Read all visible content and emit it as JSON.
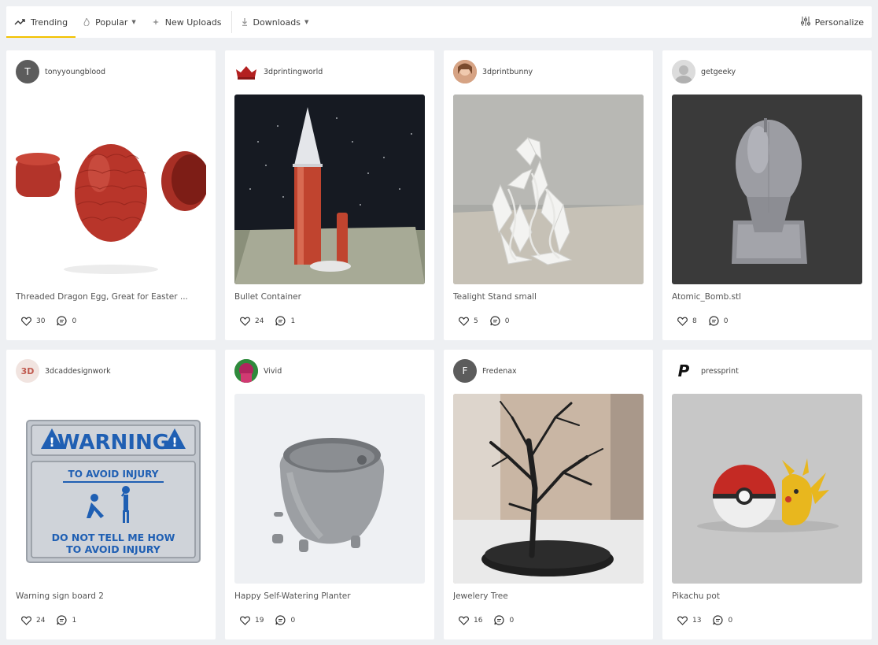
{
  "nav": {
    "tabs": [
      {
        "label": "Trending",
        "icon": "trending-icon",
        "active": true
      },
      {
        "label": "Popular",
        "icon": "flame-icon",
        "dropdown": true
      },
      {
        "label": "New Uploads",
        "icon": "sparkle-icon"
      },
      {
        "label": "Downloads",
        "icon": "download-icon",
        "dropdown": true
      }
    ],
    "personalize_label": "Personalize",
    "accent_color": "#f2c200"
  },
  "cards": [
    {
      "author": "tonyyoungblood",
      "avatar_letter": "T",
      "title": "Threaded Dragon Egg, Great for Easter ...",
      "likes": "30",
      "comments": "0"
    },
    {
      "author": "3dprintingworld",
      "avatar_letter": "",
      "title": "Bullet Container",
      "likes": "24",
      "comments": "1"
    },
    {
      "author": "3dprintbunny",
      "avatar_letter": "",
      "title": "Tealight Stand small",
      "likes": "5",
      "comments": "0"
    },
    {
      "author": "getgeeky",
      "avatar_letter": "",
      "title": "Atomic_Bomb.stl",
      "likes": "8",
      "comments": "0"
    },
    {
      "author": "3dcaddesignwork",
      "avatar_letter": "3D",
      "title": "Warning sign board 2",
      "likes": "24",
      "comments": "1"
    },
    {
      "author": "Vivid",
      "avatar_letter": "",
      "title": "Happy Self-Watering Planter",
      "likes": "19",
      "comments": "0"
    },
    {
      "author": "Fredenax",
      "avatar_letter": "F",
      "title": "Jewelery Tree",
      "likes": "16",
      "comments": "0"
    },
    {
      "author": "pressprint",
      "avatar_letter": "P",
      "title": "Pikachu pot",
      "likes": "13",
      "comments": "0"
    }
  ],
  "warning_sign": {
    "heading": "WARNING",
    "line1": "TO AVOID INJURY",
    "line2": "DO NOT TELL ME HOW",
    "line3": "TO AVOID INJURY"
  }
}
